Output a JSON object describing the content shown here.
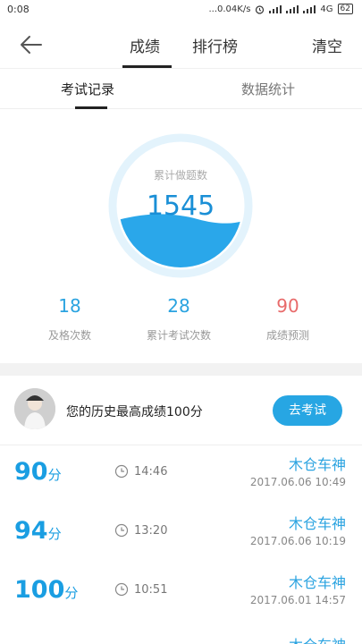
{
  "status_bar": {
    "time": "0:08",
    "network": "...0.04K/s",
    "network_type": "4G",
    "battery": "62"
  },
  "nav": {
    "tab_score": "成绩",
    "tab_ranking": "排行榜",
    "clear": "清空"
  },
  "sub_tabs": {
    "exam_records": "考试记录",
    "statistics": "数据统计"
  },
  "summary": {
    "total_label": "累计做题数",
    "total_value": "1545",
    "stats": [
      {
        "value": "18",
        "label": "及格次数",
        "color": "#2aa3e0"
      },
      {
        "value": "28",
        "label": "累计考试次数",
        "color": "#2aa3e0"
      },
      {
        "value": "90",
        "label": "成绩预测",
        "color": "#e86a6a"
      }
    ]
  },
  "best": {
    "text": "您的历史最高成绩100分",
    "button": "去考试"
  },
  "records": [
    {
      "score": "90",
      "unit": "分",
      "duration": "14:46",
      "user": "木仓车神",
      "datetime": "2017.06.06  10:49"
    },
    {
      "score": "94",
      "unit": "分",
      "duration": "13:20",
      "user": "木仓车神",
      "datetime": "2017.06.06  10:19"
    },
    {
      "score": "100",
      "unit": "分",
      "duration": "10:51",
      "user": "木仓车神",
      "datetime": "2017.06.01  14:57"
    },
    {
      "score": "",
      "unit": "",
      "duration": "",
      "user": "木仓车神",
      "datetime": ""
    }
  ],
  "colors": {
    "accent": "#27a6e3",
    "score_blue": "#1a9ee2",
    "prediction_red": "#e86a6a"
  }
}
